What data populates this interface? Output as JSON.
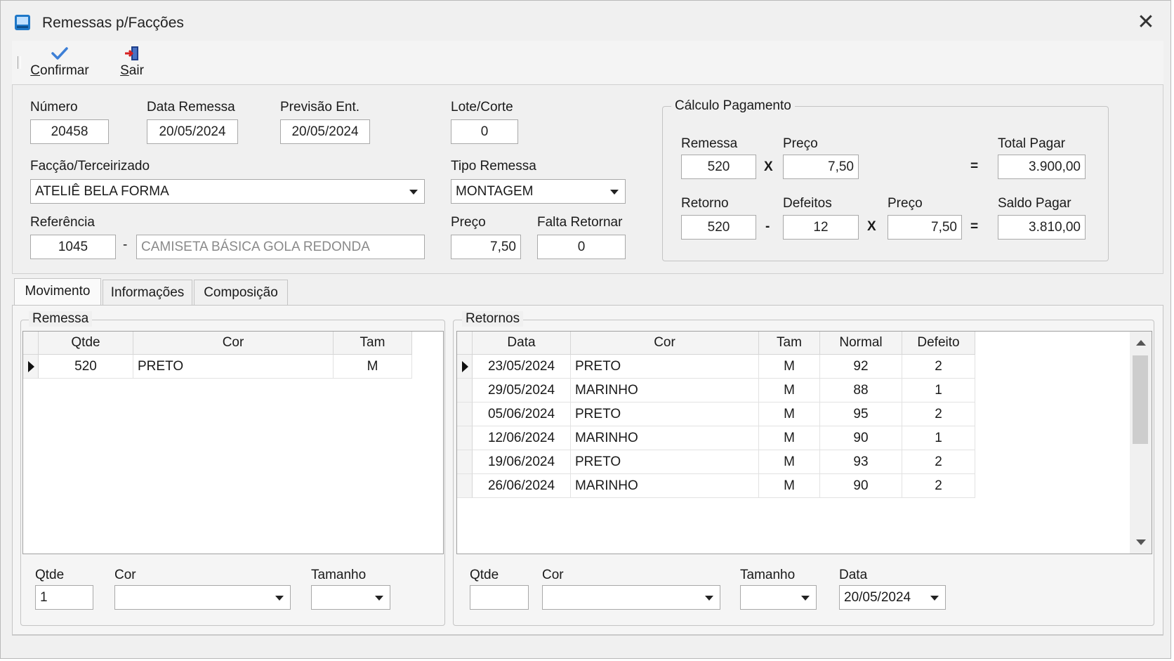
{
  "window": {
    "title": "Remessas p/Facções",
    "close_glyph": "✕",
    "accent": "#1f78c8"
  },
  "toolbar": {
    "confirm": {
      "underline": "C",
      "rest": "onfirmar",
      "icon": "checkmark-icon"
    },
    "exit": {
      "underline": "S",
      "rest": "air",
      "icon": "exit-door-icon"
    }
  },
  "header": {
    "numero": {
      "label": "Número",
      "value": "20458"
    },
    "data_remessa": {
      "label": "Data Remessa",
      "value": "20/05/2024"
    },
    "previsao": {
      "label": "Previsão Ent.",
      "value": "20/05/2024"
    },
    "lote": {
      "label": "Lote/Corte",
      "value": "0"
    },
    "faccao": {
      "label": "Facção/Terceirizado",
      "value": "ATELIÊ BELA FORMA"
    },
    "tipo": {
      "label": "Tipo Remessa",
      "value": "MONTAGEM"
    },
    "referencia": {
      "label": "Referência",
      "code": "1045",
      "dash": "-",
      "description": "CAMISETA BÁSICA GOLA REDONDA"
    },
    "preco": {
      "label": "Preço",
      "value": "7,50"
    },
    "falta": {
      "label": "Falta Retornar",
      "value": "0"
    }
  },
  "calculo": {
    "title": "Cálculo Pagamento",
    "row1": {
      "remessa_label": "Remessa",
      "remessa": "520",
      "op1": "X",
      "preco_label": "Preço",
      "preco": "7,50",
      "eq": "=",
      "total_label": "Total Pagar",
      "total": "3.900,00"
    },
    "row2": {
      "retorno_label": "Retorno",
      "retorno": "520",
      "op1": "-",
      "defeitos_label": "Defeitos",
      "defeitos": "12",
      "op2": "X",
      "preco_label": "Preço",
      "preco": "7,50",
      "eq": "=",
      "saldo_label": "Saldo Pagar",
      "saldo": "3.810,00"
    }
  },
  "tabs": [
    {
      "label": "Movimento"
    },
    {
      "label": "Informações"
    },
    {
      "label": "Composição"
    }
  ],
  "remessa": {
    "title": "Remessa",
    "columns": [
      "Qtde",
      "Cor",
      "Tam"
    ],
    "rows": [
      {
        "qtde": "520",
        "cor": "PRETO",
        "tam": "M"
      }
    ],
    "form": {
      "qtde_label": "Qtde",
      "qtde": "1",
      "cor_label": "Cor",
      "cor": "",
      "tam_label": "Tamanho",
      "tam": ""
    }
  },
  "retornos": {
    "title": "Retornos",
    "columns": [
      "Data",
      "Cor",
      "Tam",
      "Normal",
      "Defeito"
    ],
    "rows": [
      {
        "data": "23/05/2024",
        "cor": "PRETO",
        "tam": "M",
        "normal": "92",
        "defeito": "2"
      },
      {
        "data": "29/05/2024",
        "cor": "MARINHO",
        "tam": "M",
        "normal": "88",
        "defeito": "1"
      },
      {
        "data": "05/06/2024",
        "cor": "PRETO",
        "tam": "M",
        "normal": "95",
        "defeito": "2"
      },
      {
        "data": "12/06/2024",
        "cor": "MARINHO",
        "tam": "M",
        "normal": "90",
        "defeito": "1"
      },
      {
        "data": "19/06/2024",
        "cor": "PRETO",
        "tam": "M",
        "normal": "93",
        "defeito": "2"
      },
      {
        "data": "26/06/2024",
        "cor": "MARINHO",
        "tam": "M",
        "normal": "90",
        "defeito": "2"
      }
    ],
    "form": {
      "qtde_label": "Qtde",
      "qtde": "",
      "cor_label": "Cor",
      "cor": "",
      "tam_label": "Tamanho",
      "tam": "",
      "data_label": "Data",
      "data": "20/05/2024"
    }
  }
}
